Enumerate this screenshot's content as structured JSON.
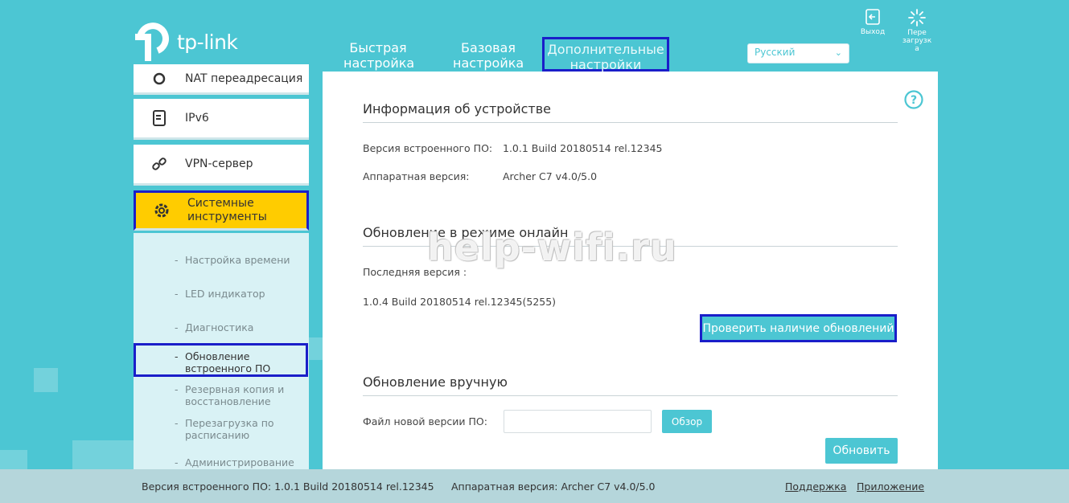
{
  "header": {
    "logo_text": "tp-link",
    "nav": [
      {
        "line1": "Быстрая",
        "line2": "настройка"
      },
      {
        "line1": "Базовая",
        "line2": "настройка"
      },
      {
        "line1": "Дополнительные",
        "line2": "настройки"
      }
    ],
    "language": "Русский",
    "logout_label": "Выход",
    "reboot_label": [
      "Пере",
      "загрузк",
      "а"
    ]
  },
  "sidebar": {
    "items": [
      {
        "label": "NAT переадресация",
        "icon": "nat-icon"
      },
      {
        "label": "IPv6",
        "icon": "ipv6-icon"
      },
      {
        "label": "VPN-сервер",
        "icon": "link-icon"
      },
      {
        "label_line1": "Системные",
        "label_line2": "инструменты",
        "icon": "gear-icon",
        "active": true
      }
    ],
    "submenu": [
      {
        "lines": [
          "Настройка времени"
        ]
      },
      {
        "lines": [
          "LED индикатор"
        ]
      },
      {
        "lines": [
          "Диагностика"
        ]
      },
      {
        "lines": [
          "Обновление",
          "встроенного ПО"
        ],
        "active": true
      },
      {
        "lines": [
          "Резервная копия и",
          "восстановление"
        ]
      },
      {
        "lines": [
          "Перезагрузка по",
          "расписанию"
        ]
      },
      {
        "lines": [
          "Администрирование"
        ]
      }
    ]
  },
  "main": {
    "device_info": {
      "title": "Информация об устройстве",
      "fw_label": "Версия встроенного ПО:",
      "fw_value": "1.0.1 Build 20180514 rel.12345",
      "hw_label": "Аппаратная версия:",
      "hw_value": "Archer C7 v4.0/5.0"
    },
    "online_update": {
      "title": "Обновление в режиме онлайн",
      "latest_label": "Последняя версия :",
      "latest_value": "1.0.4 Build 20180514 rel.12345(5255)",
      "check_button": "Проверить наличие обновлений"
    },
    "manual_update": {
      "title": "Обновление вручную",
      "file_label": "Файл новой версии ПО:",
      "file_value": "",
      "browse_button": "Обзор",
      "update_button": "Обновить"
    },
    "watermark": "help-wifi.ru"
  },
  "footer": {
    "fw_text": "Версия встроенного ПО: 1.0.1 Build 20180514 rel.12345",
    "hw_text": "Аппаратная версия: Archer C7 v4.0/5.0",
    "support_link": "Поддержка",
    "app_link": "Приложение"
  },
  "colors": {
    "background": "#4cc6d3",
    "active_menu": "#ffcc00",
    "highlight_border": "#1a1ec9",
    "button": "#4cc6d3"
  }
}
